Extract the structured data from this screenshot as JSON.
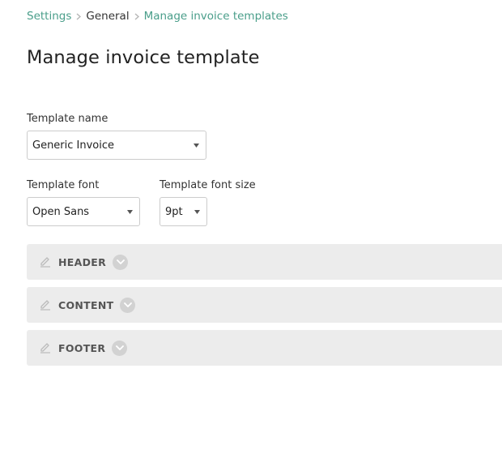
{
  "breadcrumb": {
    "items": [
      {
        "label": "Settings"
      },
      {
        "label": "General"
      },
      {
        "label": "Manage invoice templates"
      }
    ]
  },
  "page": {
    "title": "Manage invoice template"
  },
  "form": {
    "template_name": {
      "label": "Template name",
      "value": "Generic Invoice"
    },
    "template_font": {
      "label": "Template font",
      "value": "Open Sans"
    },
    "template_font_size": {
      "label": "Template font size",
      "value": "9pt"
    }
  },
  "sections": [
    {
      "label": "HEADER",
      "icon": "pencil-icon"
    },
    {
      "label": "CONTENT",
      "icon": "pencil-icon"
    },
    {
      "label": "FOOTER",
      "icon": "pencil-icon"
    }
  ],
  "colors": {
    "link": "#4a9e8a",
    "section_bg": "#ececec",
    "chevron_bg": "#d2d2d2"
  }
}
